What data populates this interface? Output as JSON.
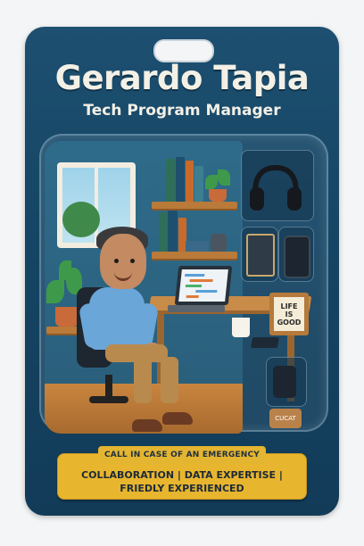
{
  "header": {
    "name": "Gerardo Tapia",
    "role": "Tech Program Manager"
  },
  "scene": {
    "frame_sign": [
      "LIFE",
      "IS",
      "GOOD"
    ],
    "accessory_tag": "CUCAT"
  },
  "footer": {
    "emergency_label": "CALL IN CASE OF AN EMERGENCY",
    "traits": "COLLABORATION | DATA EXPERTISE | FRIEDLY EXPERIENCED"
  },
  "colors": {
    "card_blue": "#1a4a6a",
    "banner_yellow": "#e8b52e",
    "title_cream": "#f3f0e6"
  }
}
